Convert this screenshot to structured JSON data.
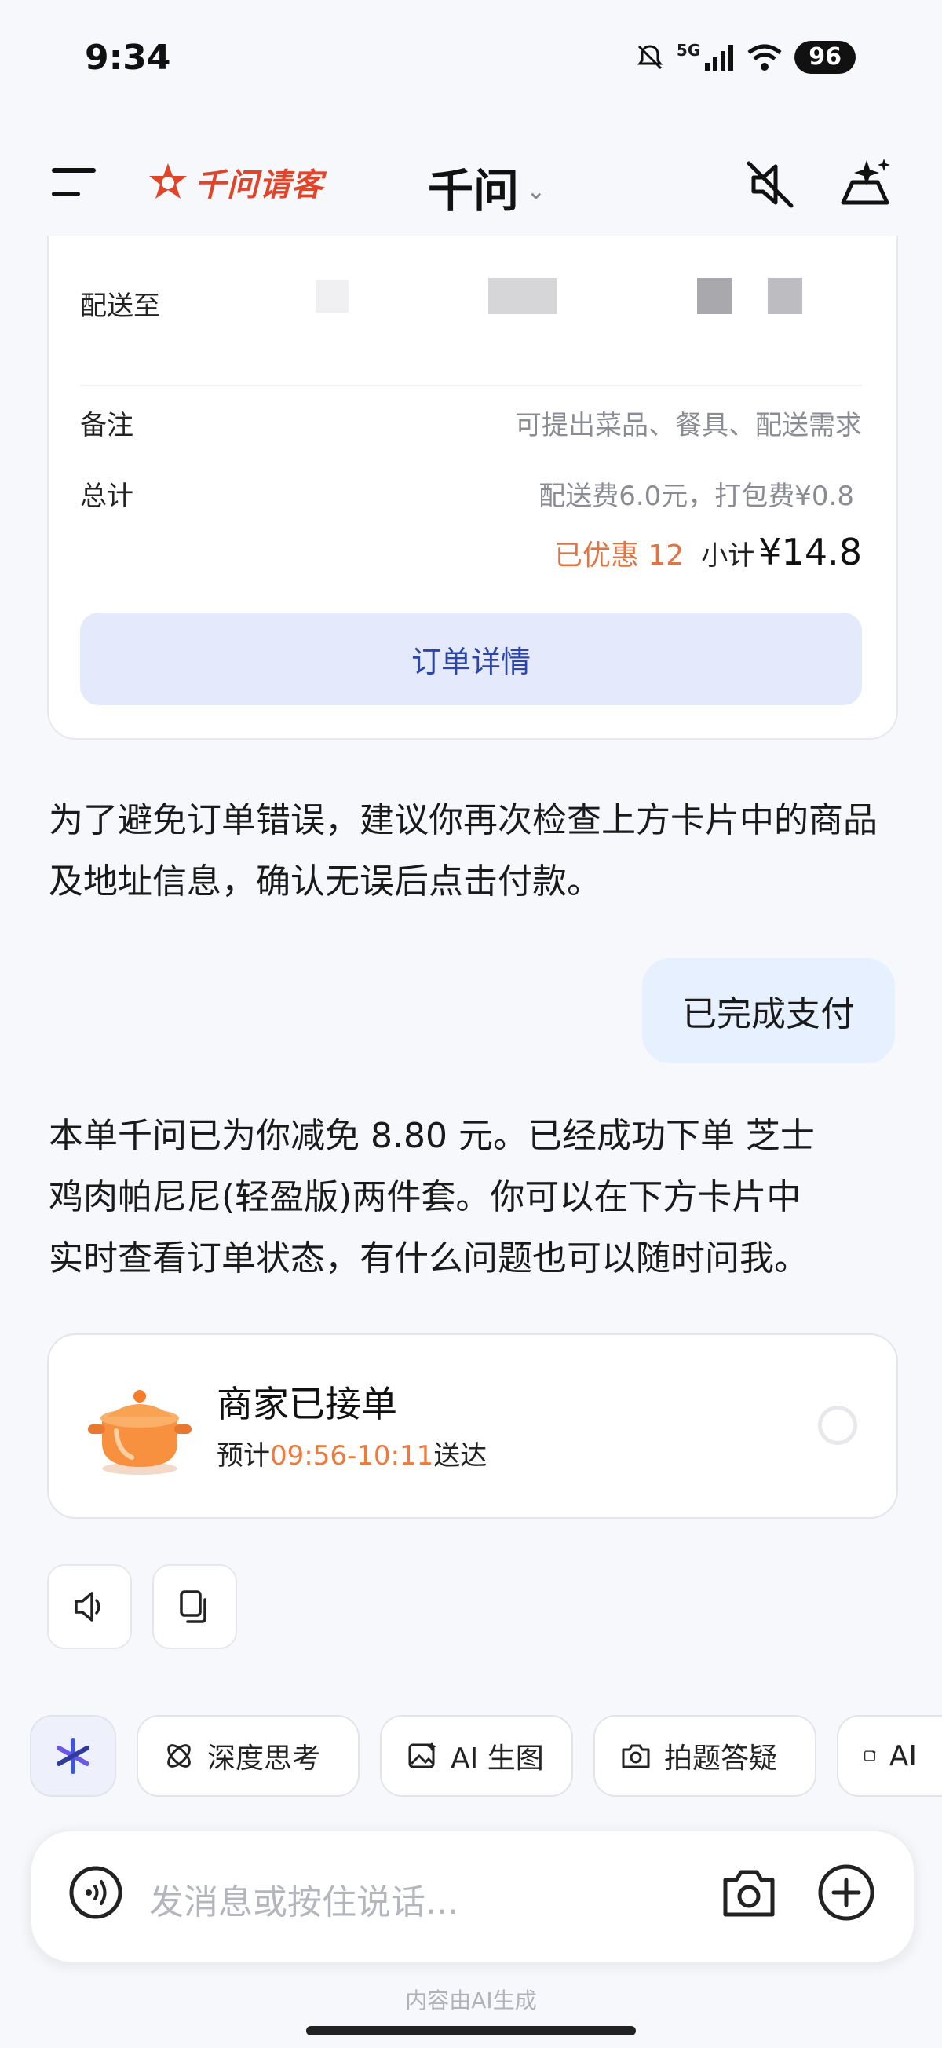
{
  "status_bar": {
    "time": "9:34",
    "network": "5G",
    "battery": "96"
  },
  "header": {
    "brand": "千问请客",
    "title": "千问",
    "title_chevron": "⌄"
  },
  "order_card": {
    "deliver_to_label": "配送至",
    "note_label": "备注",
    "note_placeholder": "可提出菜品、餐具、配送需求",
    "total_label": "总计",
    "fees_text": "配送费6.0元，打包费¥0.8",
    "discount_text": "已优惠 12",
    "subtotal_label": "小计",
    "subtotal_value": "¥14.8",
    "detail_button": "订单详情"
  },
  "messages": {
    "assistant_1": "为了避免订单错误，建议你再次检查上方卡片中的商品及地址信息，确认无误后点击付款。",
    "user_1": "已完成支付",
    "assistant_2_line1": "本单千问已为你减免 8.80 元。已经成功下单 芝士",
    "assistant_2_line2": "鸡肉帕尼尼(轻盈版)两件套。你可以在下方卡片中",
    "assistant_2_line3": "实时查看订单状态，有什么问题也可以随时问我。"
  },
  "status_card": {
    "title": "商家已接单",
    "eta_prefix": "预计",
    "eta_time": "09:56-10:11",
    "eta_suffix": "送达"
  },
  "chips": [
    {
      "label": "深度思考",
      "icon": "deep-think-icon"
    },
    {
      "label": "AI 生图",
      "icon": "image-gen-icon"
    },
    {
      "label": "拍题答疑",
      "icon": "camera-question-icon"
    },
    {
      "label": "AI",
      "icon": "ai-more-icon"
    }
  ],
  "input": {
    "placeholder": "发消息或按住说话..."
  },
  "footer_note": "内容由AI生成",
  "colors": {
    "accent_orange": "#e07443",
    "brand_red": "#e0452b",
    "button_blue": "#2b45a8",
    "user_bubble": "#e6f0ff"
  }
}
